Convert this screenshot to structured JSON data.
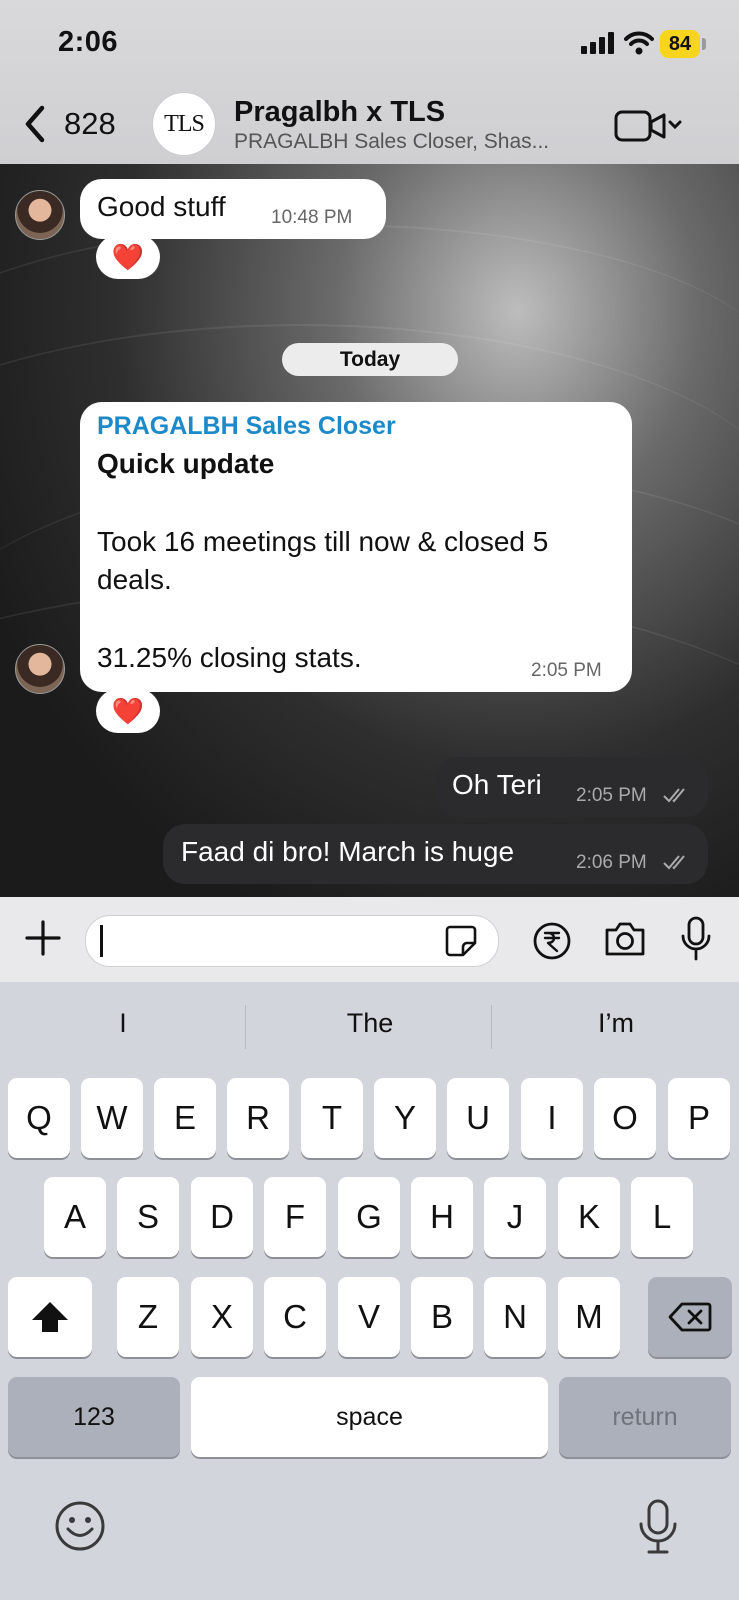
{
  "status_bar": {
    "time": "2:06",
    "battery": "84"
  },
  "header": {
    "back_count": "828",
    "avatar_text": "TLS",
    "title": "Pragalbh x TLS",
    "subtitle": "PRAGALBH Sales Closer, Shas..."
  },
  "chat": {
    "day_label": "Today",
    "messages": [
      {
        "text": "Good stuff",
        "time": "10:48 PM",
        "reaction": "❤️"
      },
      {
        "sender": "PRAGALBH Sales Closer",
        "title": "Quick update",
        "line1": "Took 16 meetings till now & closed 5",
        "line2": "deals.",
        "line3": "31.25% closing stats.",
        "time": "2:05 PM",
        "reaction": "❤️"
      },
      {
        "text": "Oh Teri",
        "time": "2:05 PM"
      },
      {
        "text": "Faad di bro! March is huge",
        "time": "2:06 PM"
      }
    ]
  },
  "keyboard": {
    "suggestions": [
      "I",
      "The",
      "I’m"
    ],
    "row1": [
      "Q",
      "W",
      "E",
      "R",
      "T",
      "Y",
      "U",
      "I",
      "O",
      "P"
    ],
    "row2": [
      "A",
      "S",
      "D",
      "F",
      "G",
      "H",
      "J",
      "K",
      "L"
    ],
    "row3": [
      "Z",
      "X",
      "C",
      "V",
      "B",
      "N",
      "M"
    ],
    "numbers_label": "123",
    "space_label": "space",
    "return_label": "return"
  }
}
